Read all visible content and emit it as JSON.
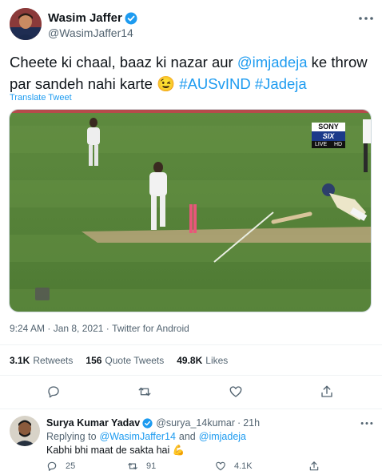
{
  "tweet": {
    "author": {
      "name": "Wasim Jaffer",
      "handle": "@WasimJaffer14",
      "verified": true
    },
    "text": {
      "line1_a": "Cheete ki chaal, baaz ki nazar aur ",
      "mention": "@imjadeja",
      "line1_b": " ke throw",
      "line2_a": "par sandeh nahi karte ",
      "emoji": "😉",
      "hashtag1": "#AUSvIND",
      "hashtag2": "#Jadeja"
    },
    "translate": "Translate Tweet",
    "media": {
      "broadcaster": "SONY",
      "channel": "SIX",
      "live": "LIVE",
      "hd": "HD"
    },
    "meta": {
      "time": "9:24 AM",
      "date": "Jan 8, 2021",
      "separator": " · ",
      "client": "Twitter for Android"
    },
    "stats": {
      "retweets_count": "3.1K",
      "retweets_label": "Retweets",
      "quotes_count": "156",
      "quotes_label": "Quote Tweets",
      "likes_count": "49.8K",
      "likes_label": "Likes"
    },
    "actions": [
      "reply-icon",
      "retweet-icon",
      "like-icon",
      "share-icon"
    ]
  },
  "reply": {
    "author": {
      "name": "Surya Kumar Yadav",
      "handle": "@surya_14kumar",
      "time": "21h",
      "dot": "·",
      "verified": true
    },
    "replying_to_label": "Replying to",
    "replying_to_1": "@WasimJaffer14",
    "and": "and",
    "replying_to_2": "@imjadeja",
    "text": "Kabhi bhi maat de sakta hai",
    "emoji": "💪",
    "counts": {
      "replies": "25",
      "retweets": "91",
      "likes": "4.1K"
    }
  },
  "colors": {
    "accent": "#1d9bf0",
    "text": "#0f1419",
    "muted": "#536471",
    "divider": "#eff3f4"
  }
}
